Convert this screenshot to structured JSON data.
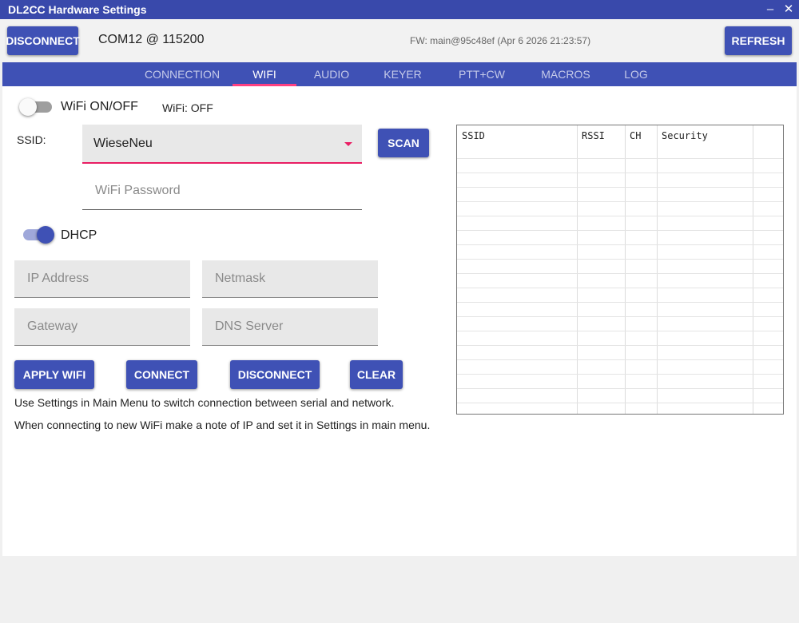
{
  "window": {
    "title": "DL2CC Hardware Settings",
    "minimize_glyph": "–",
    "close_glyph": "✕"
  },
  "toolbar": {
    "disconnect_label": "DISCONNECT",
    "port": "COM12 @ 115200",
    "firmware": "FW: main@95c48ef (Apr  6 2026 21:23:57)",
    "refresh_label": "REFRESH"
  },
  "tabs": [
    {
      "label": "CONNECTION",
      "active": false
    },
    {
      "label": "WIFI",
      "active": true
    },
    {
      "label": "AUDIO",
      "active": false
    },
    {
      "label": "KEYER",
      "active": false
    },
    {
      "label": "PTT+CW",
      "active": false
    },
    {
      "label": "MACROS",
      "active": false
    },
    {
      "label": "LOG",
      "active": false
    }
  ],
  "wifi": {
    "toggle_label": "WiFi ON/OFF",
    "toggle_on": false,
    "status": "WiFi: OFF",
    "ssid_label": "SSID:",
    "ssid_value": "WieseNeu",
    "scan_label": "SCAN",
    "password_placeholder": "WiFi Password",
    "dhcp_label": "DHCP",
    "dhcp_on": true,
    "ip_placeholder": "IP Address",
    "netmask_placeholder": "Netmask",
    "gateway_placeholder": "Gateway",
    "dns_placeholder": "DNS Server",
    "buttons": {
      "apply": "APPLY WIFI",
      "connect": "CONNECT",
      "disconnect": "DISCONNECT",
      "clear": "CLEAR"
    },
    "note1": "Use Settings in Main Menu to switch connection between serial and network.",
    "note2": "When connecting to new WiFi make a note of IP and set it in Settings in main menu."
  },
  "scan_table": {
    "columns": [
      "SSID",
      "RSSI",
      "CH",
      "Security"
    ],
    "rows": []
  },
  "colors": {
    "primary": "#3f51b5",
    "titlebar": "#3949ab",
    "accent": "#e91e63",
    "tab_indicator": "#ff4081"
  }
}
